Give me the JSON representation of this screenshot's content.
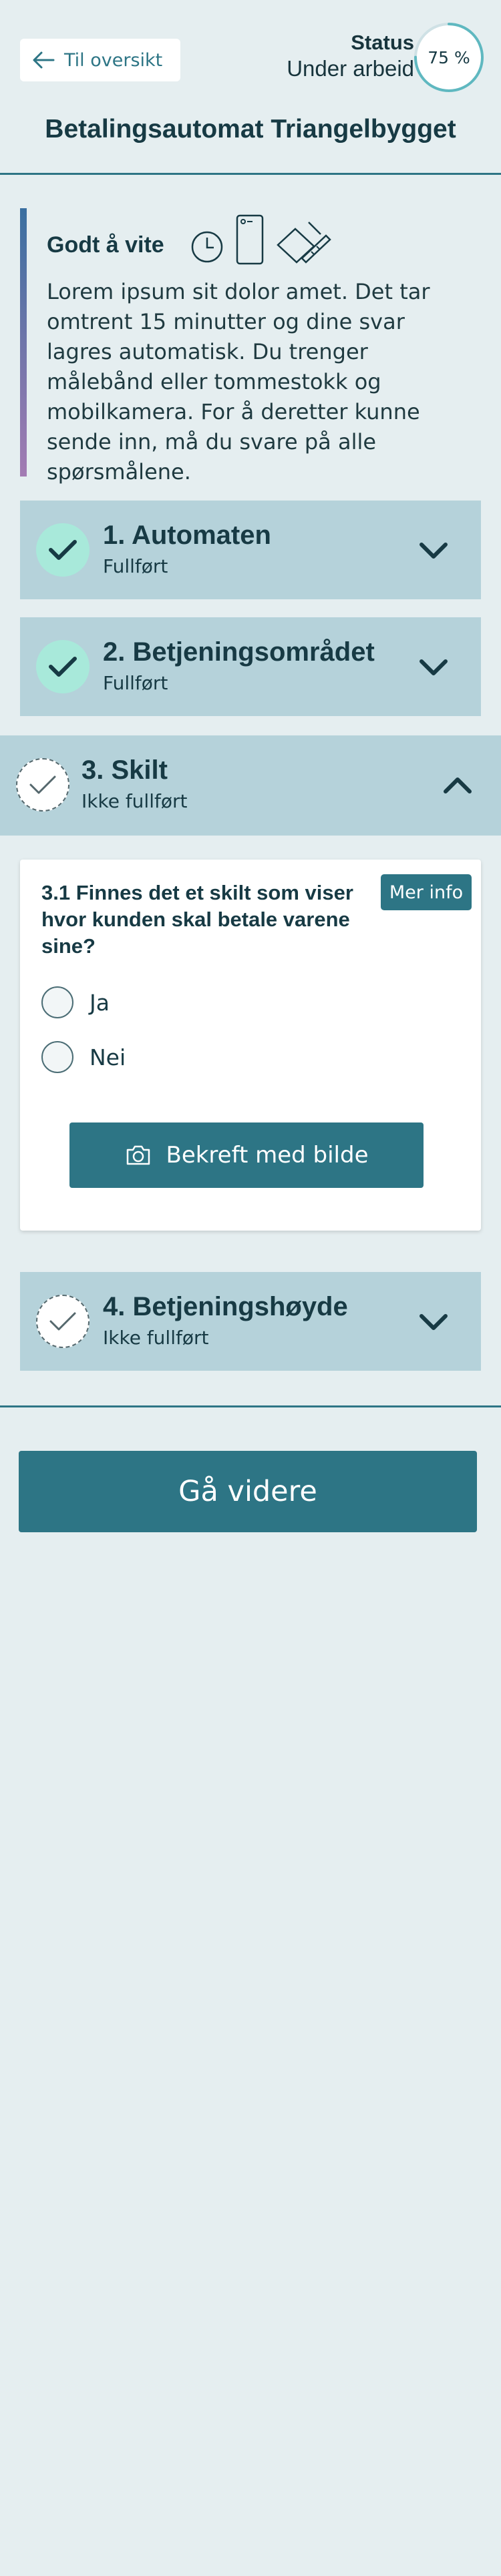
{
  "header": {
    "back_label": "Til oversikt",
    "status_label": "Status",
    "status_value": "Under arbeid",
    "progress_text": "75 %",
    "progress_percent": 75
  },
  "page": {
    "title": "Betalingsautomat Triangelbygget"
  },
  "info": {
    "title": "Godt å vite",
    "icons": [
      "clock-icon",
      "phone-icon",
      "measuring-tape-icon"
    ],
    "text": "Lorem ipsum sit dolor amet. Det tar omtrent 15 minutter og dine svar lagres automatisk. Du trenger målebånd eller tommestokk og mobilkamera. For å deretter kunne sende inn, må du svare på alle spørsmålene."
  },
  "sections": [
    {
      "title": "1. Automaten",
      "status": "Fullført",
      "completed": true
    },
    {
      "title": "2. Betjeningsområdet",
      "status": "Fullført",
      "completed": true
    },
    {
      "title": "3. Skilt",
      "status": "Ikke fullført",
      "completed": false,
      "expanded": true
    },
    {
      "title": "4. Betjeningshøyde",
      "status": "Ikke fullført",
      "completed": false
    }
  ],
  "question": {
    "text": "3.1 Finnes det et skilt som viser hvor kunden skal betale varene sine?",
    "info_label": "Mer info",
    "options": [
      "Ja",
      "Nei"
    ],
    "photo_button": "Bekreft med bilde"
  },
  "footer": {
    "continue_label": "Gå videre"
  },
  "colors": {
    "accent": "#2d7585",
    "card": "#b5d2da",
    "check": "#a8e9da",
    "background": "#e5eef0"
  }
}
